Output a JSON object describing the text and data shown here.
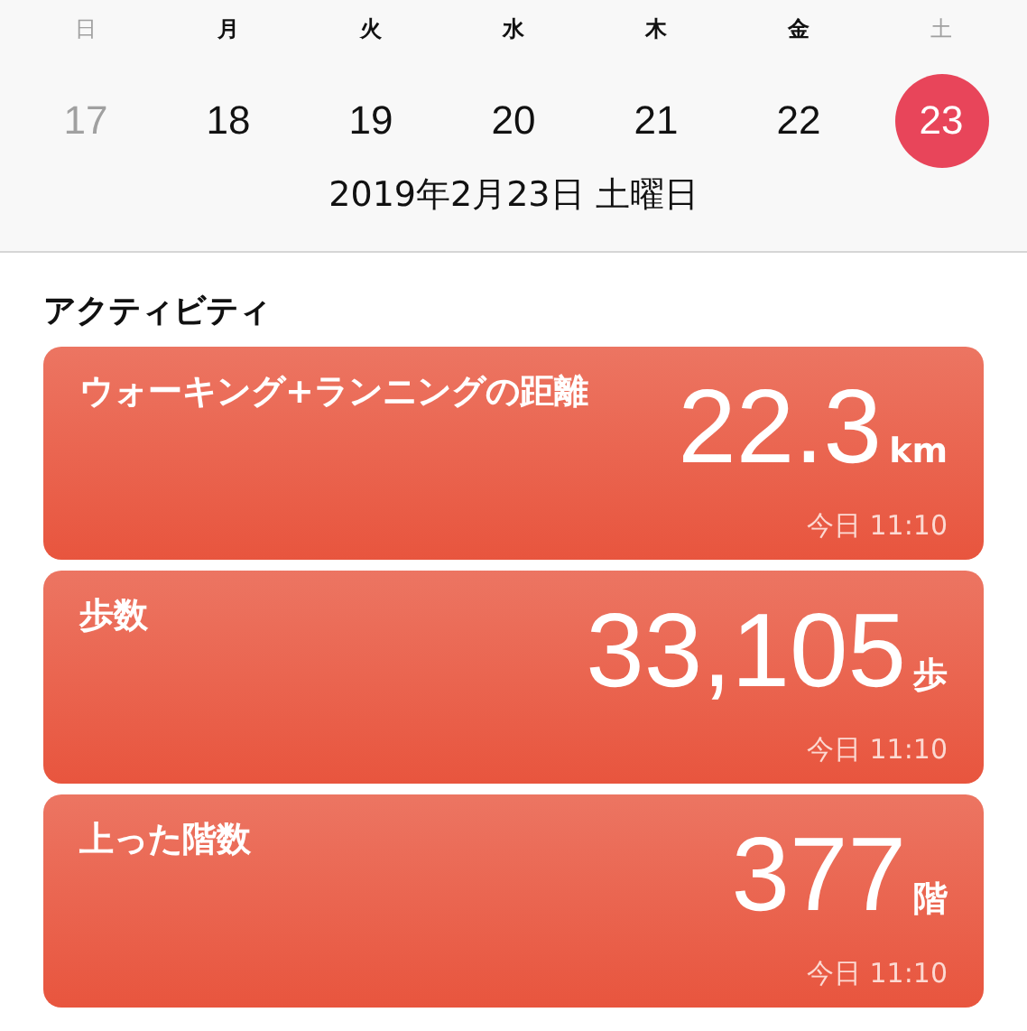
{
  "week": [
    {
      "weekday": "日",
      "day": "17",
      "weekend": true,
      "selected": false
    },
    {
      "weekday": "月",
      "day": "18",
      "weekend": false,
      "selected": false
    },
    {
      "weekday": "火",
      "day": "19",
      "weekend": false,
      "selected": false
    },
    {
      "weekday": "水",
      "day": "20",
      "weekend": false,
      "selected": false
    },
    {
      "weekday": "木",
      "day": "21",
      "weekend": false,
      "selected": false
    },
    {
      "weekday": "金",
      "day": "22",
      "weekend": false,
      "selected": false
    },
    {
      "weekday": "土",
      "day": "23",
      "weekend": true,
      "selected": true
    }
  ],
  "date": "2019年2月23日 土曜日",
  "section_title": "アクティビティ",
  "cards": [
    {
      "title": "ウォーキング+ランニングの距離",
      "value": "22.3",
      "unit": "km",
      "time": "今日 11:10"
    },
    {
      "title": "歩数",
      "value": "33,105",
      "unit": "歩",
      "time": "今日 11:10"
    },
    {
      "title": "上った階数",
      "value": "377",
      "unit": "階",
      "time": "今日 11:10"
    }
  ]
}
